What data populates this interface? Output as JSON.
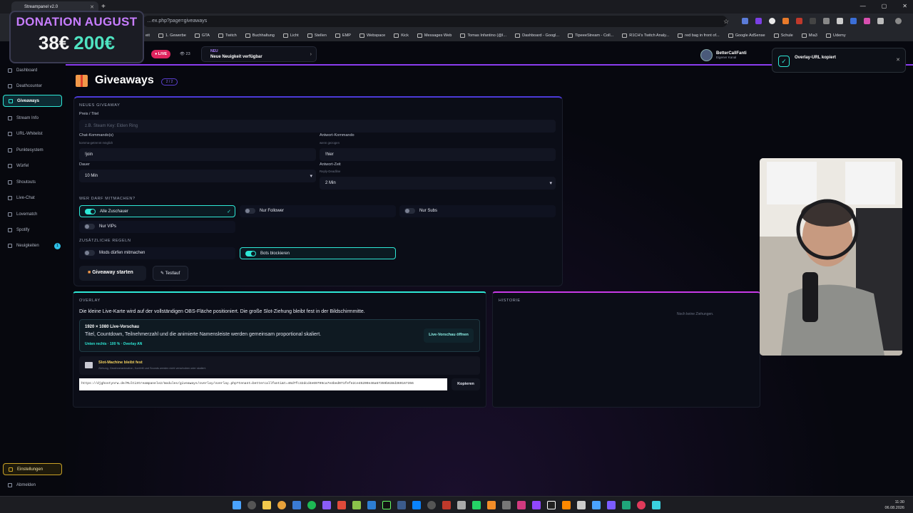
{
  "browser": {
    "tab_title": "Streampanel v2.0",
    "url": "…ex.php?page=giveaways",
    "bookmarks": [
      "eit",
      "1. Gewerbe",
      "GTA",
      "Twitch",
      "Buchhaltung",
      "Licht",
      "Stellen",
      "EMP",
      "Webspace",
      "Kick",
      "Messages Web",
      "Tomas Infantino (@I...",
      "Dashboard - Googl...",
      "TipeeeStream - Coll...",
      "R1CH's Twitch Analy...",
      "red bag in front of...",
      "Google AdSense",
      "Schule",
      "Mia3",
      "Udemy"
    ]
  },
  "donation": {
    "title": "DONATION AUGUST",
    "current": "38€",
    "goal": "200€"
  },
  "topbar": {
    "live_label": "● LIVE",
    "viewers": "👁 23",
    "news_tag": "NEU",
    "news_text": "Neue Neuigkeit verfügbar",
    "user_name": "BetterCallFanti",
    "user_sub": "Eigener Kanal"
  },
  "sidebar": {
    "items": [
      {
        "label": "Dashboard"
      },
      {
        "label": "Deathcounter"
      },
      {
        "label": "Giveaways"
      },
      {
        "label": "Stream Info"
      },
      {
        "label": "URL-Whitelist"
      },
      {
        "label": "Punktesystem"
      },
      {
        "label": "Würfel"
      },
      {
        "label": "Shoutouts"
      },
      {
        "label": "Live-Chat"
      },
      {
        "label": "Lovematch"
      },
      {
        "label": "Spotify"
      },
      {
        "label": "Neuigkeiten"
      }
    ],
    "news_badge": "1",
    "settings": "Einstellungen",
    "logout": "Abmelden"
  },
  "page": {
    "title": "Giveaways",
    "count": "2 / 2"
  },
  "form": {
    "section": "NEUES GIVEAWAY",
    "prize_label": "Preis / Titel",
    "prize_placeholder": "z.B. Steam Key: Elden Ring",
    "chat_cmd_label": "Chat-Kommando(s)",
    "chat_cmd_sub": "komma-getrennt möglich",
    "chat_cmd_value": "!join",
    "answer_cmd_label": "Antwort-Kommando",
    "answer_cmd_sub": "wenn gezogen",
    "answer_cmd_value": "!hier",
    "duration_label": "Dauer",
    "duration_value": "10 Min",
    "answer_time_label": "Antwort-Zeit",
    "answer_time_sub": "Reply-Deadline",
    "answer_time_value": "2 Min",
    "who_section": "WER DARF MITMACHEN?",
    "who_options": [
      {
        "label": "Alle Zuschauer",
        "on": true
      },
      {
        "label": "Nur Follower",
        "on": false
      },
      {
        "label": "Nur Subs",
        "on": false
      },
      {
        "label": "Nur VIPs",
        "on": false
      }
    ],
    "extra_section": "ZUSÄTZLICHE REGELN",
    "extra_options": [
      {
        "label": "Mods dürfen mitmachen",
        "on": false
      },
      {
        "label": "Bots blockieren",
        "on": true
      }
    ],
    "start_button": "Giveaway starten",
    "test_button": "Testlauf"
  },
  "overlay": {
    "section": "OVERLAY",
    "description": "Die kleine Live-Karte wird auf der vollständigen OBS-Fläche positioniert. Die große Slot-Ziehung bleibt fest in der Bildschirmmitte.",
    "preview_title": "1920 × 1080 Live-Vorschau",
    "preview_text": "Titel, Countdown, Teilnehmerzahl und die animierte Namensleiste werden gemeinsam proportional skaliert.",
    "preview_status": "Unten rechts · 100 % · Overlay AN",
    "preview_button": "Live-Vorschau öffnen",
    "slot_title": "Slot-Machine bleibt fest",
    "slot_sub": "Ziehung, Gewinneranimation, Konfetti und Sounds werden nicht verschoben oder skaliert.",
    "overlay_url": "https://djghostynrw.de/MultiStreampanelv2/modules/giveaways/overlay/overlay.php?tenant=bettercallfanti&t=46d7fc32dcd4e69799ca7e4bed071fefe2ce45209e46a67359b638d369167356",
    "copy_button": "Kopieren"
  },
  "history": {
    "section": "HISTORIE",
    "empty": "Noch keine Ziehungen."
  },
  "toast": {
    "text": "Overlay-URL kopiert"
  },
  "taskbar": {
    "time": "11:30",
    "date": "06.08.2026"
  },
  "colors": {
    "accent": "#2ee8d6",
    "purple": "#8a3cf0",
    "live": "#e0245e",
    "donation_title": "#c77dff",
    "donation_goal": "#4fe3c1"
  }
}
